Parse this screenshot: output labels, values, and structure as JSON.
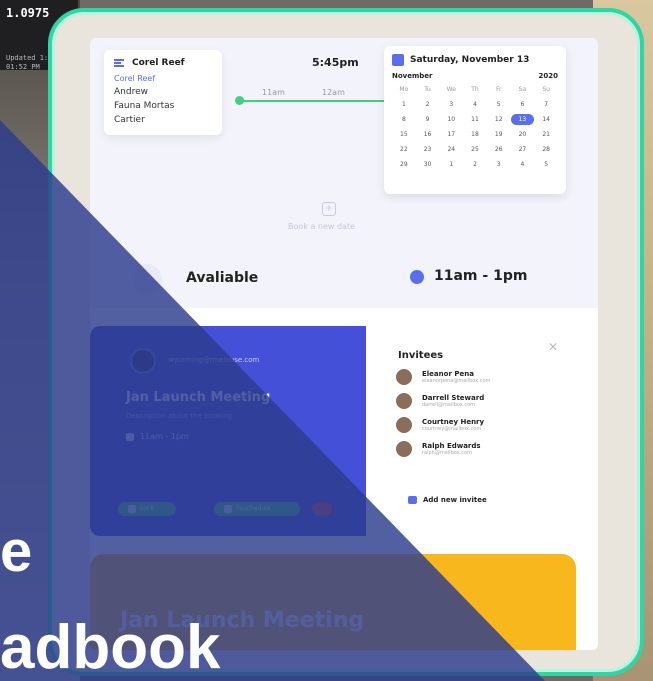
{
  "ticker": {
    "value": "1.0975",
    "line1": "Updated 1:48",
    "line2": "01:52 PM"
  },
  "header": {
    "selected_user": "Corel Reef",
    "time": "5:45pm"
  },
  "user_menu": [
    "Corel Reef",
    "Andrew",
    "Fauna Mortas",
    "Cartier"
  ],
  "timeline": [
    "11am",
    "12am"
  ],
  "calendar": {
    "date_label": "Saturday, November 13",
    "month": "November",
    "year": "2020",
    "weekdays": [
      "Mo",
      "Tu",
      "We",
      "Th",
      "Fr",
      "Sa",
      "Su"
    ],
    "days": [
      "1",
      "2",
      "3",
      "4",
      "5",
      "6",
      "7",
      "8",
      "9",
      "10",
      "11",
      "12",
      "13",
      "14",
      "15",
      "16",
      "17",
      "18",
      "19",
      "20",
      "21",
      "22",
      "23",
      "24",
      "25",
      "26",
      "27",
      "28",
      "29",
      "30",
      "1",
      "2",
      "3",
      "4",
      "5"
    ],
    "today": "13"
  },
  "booking": {
    "label": "Book a new date"
  },
  "availability": {
    "label": "Avaliable",
    "time": "11am - 1pm"
  },
  "meeting": {
    "host_role": "Organizer",
    "email": "wyurming@rmeiouse.com",
    "title": "Jan Launch Meeting",
    "description": "Description about the booking",
    "time": "11am - 1pm",
    "lock_label": "Lock",
    "reschedule_label": "Reschedule"
  },
  "invitees": {
    "title": "Invitees",
    "list": [
      {
        "name": "Eleanor Pena",
        "email": "eleanorpena@mailbox.com"
      },
      {
        "name": "Darrell Steward",
        "email": "darrell@mailbox.com"
      },
      {
        "name": "Courtney Henry",
        "email": "courtney@mailbox.com"
      },
      {
        "name": "Ralph Edwards",
        "email": "ralph@mailbox.com"
      }
    ],
    "add_label": "Add new invitee"
  },
  "yellow_card": {
    "title": "Jan Launch Meeting"
  },
  "overlay": {
    "line1": "e",
    "line2": "adbook"
  },
  "colors": {
    "accent": "#5c6ef0",
    "green": "#3ed37a",
    "meeting_bg": "#4450d8",
    "yellow": "#f7b71d",
    "bezel_glow": "#2fd5a2"
  }
}
